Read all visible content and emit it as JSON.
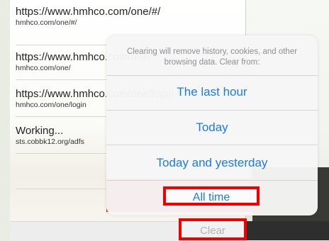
{
  "history": [
    {
      "url": "https://www.hmhco.com/one/#/",
      "domain": "hmhco.com/one/#/"
    },
    {
      "url": "https://www.hmhco.com/one/",
      "domain": "hmhco.com/one/"
    },
    {
      "url": "https://www.hmhco.com/one/login",
      "domain": "hmhco.com/one/login"
    },
    {
      "url": "Working...",
      "domain": "sts.cobbk12.org/adfs"
    }
  ],
  "clear_sheet": {
    "message": "Clearing will remove history, cookies, and other browsing data. Clear from:",
    "options": [
      "The last hour",
      "Today",
      "Today and yesterday",
      "All time"
    ]
  },
  "footer": {
    "clear_label": "Clear"
  },
  "colors": {
    "accent": "#1b7be8",
    "highlight": "#ff0000"
  }
}
